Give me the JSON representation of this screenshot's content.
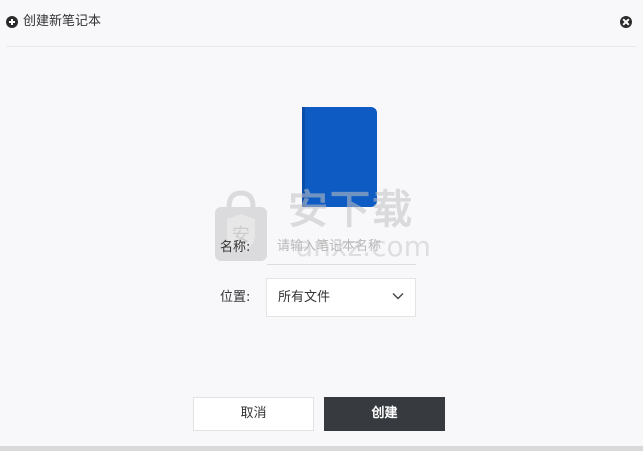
{
  "dialog": {
    "title": "创建新笔记本",
    "icons": {
      "title_icon": "plus-circle-icon",
      "close_icon": "close-circle-icon"
    }
  },
  "notebook": {
    "cover_color": "#0f5bc4"
  },
  "form": {
    "name_label": "名称:",
    "name_placeholder": "请输入笔记本名称",
    "name_value": "",
    "location_label": "位置:",
    "location_selected": "所有文件"
  },
  "buttons": {
    "cancel": "取消",
    "create": "创建"
  },
  "watermark": {
    "text": "安下载",
    "url": "anxz.com",
    "badge": "安"
  },
  "colors": {
    "primary_button": "#373a3f",
    "background": "#f8f7fa"
  }
}
